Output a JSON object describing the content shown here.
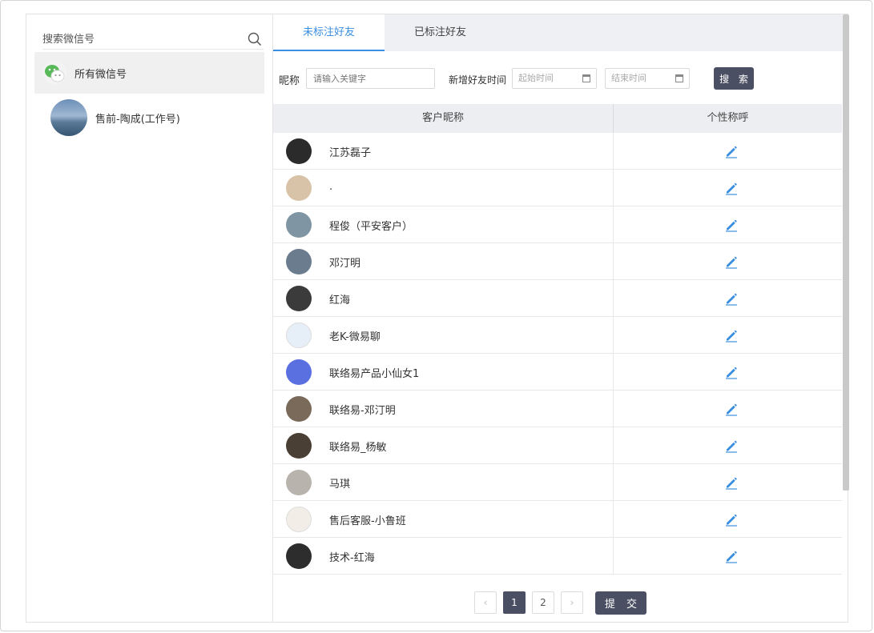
{
  "sidebar": {
    "search_placeholder": "搜索微信号",
    "accounts": [
      {
        "label": "所有微信号",
        "selected": true
      },
      {
        "label": "售前-陶成(工作号)",
        "selected": false
      }
    ]
  },
  "tabs": [
    {
      "label": "未标注好友",
      "active": true
    },
    {
      "label": "已标注好友",
      "active": false
    }
  ],
  "filters": {
    "nickname_label": "昵称",
    "nickname_placeholder": "请输入关键字",
    "time_label": "新增好友时间",
    "start_placeholder": "起始时间",
    "end_placeholder": "结束时间",
    "search_button": "搜 索"
  },
  "table": {
    "headers": [
      "客户昵称",
      "个性称呼"
    ],
    "rows": [
      {
        "name": "江苏磊子",
        "avatar_color": "#2b2b2b"
      },
      {
        "name": ".",
        "avatar_color": "#d9c3a8"
      },
      {
        "name": "程俊（平安客户）",
        "avatar_color": "#7f95a3"
      },
      {
        "name": "邓汀明",
        "avatar_color": "#6b7c8e"
      },
      {
        "name": "红海",
        "avatar_color": "#3b3b3b"
      },
      {
        "name": "老K-微易聊",
        "avatar_color": "#e6eef7"
      },
      {
        "name": "联络易产品小仙女1",
        "avatar_color": "#5a6fe0"
      },
      {
        "name": "联络易-邓汀明",
        "avatar_color": "#7a6a5a"
      },
      {
        "name": "联络易_杨敏",
        "avatar_color": "#4a3f35"
      },
      {
        "name": "马琪",
        "avatar_color": "#b9b3ad"
      },
      {
        "name": "售后客服-小鲁班",
        "avatar_color": "#f2ede6"
      },
      {
        "name": "技术-红海",
        "avatar_color": "#2d2d2d"
      }
    ],
    "edit_icon_color": "#3b8fe0"
  },
  "pagination": {
    "prev": "‹",
    "pages": [
      "1",
      "2"
    ],
    "current": "1",
    "next": "›",
    "submit_button": "提 交"
  }
}
